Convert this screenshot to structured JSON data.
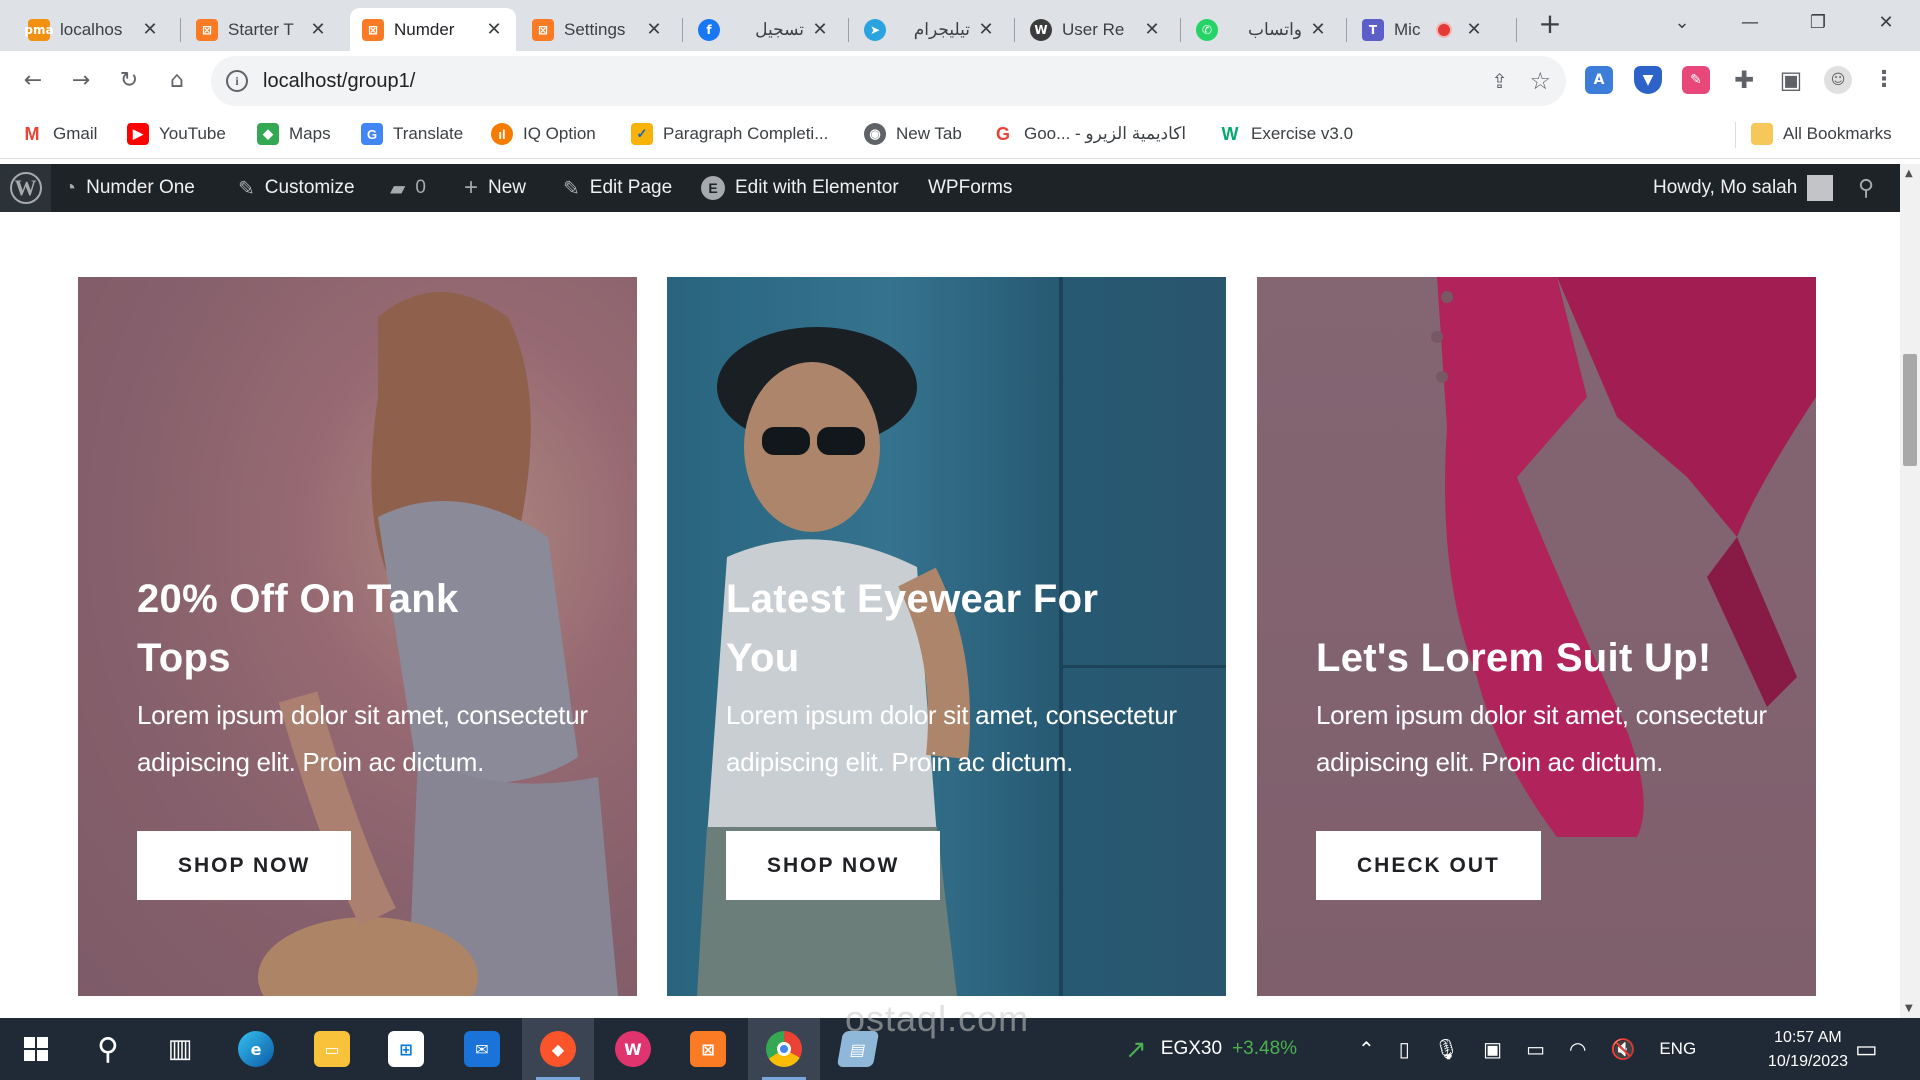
{
  "browser": {
    "tabs": [
      {
        "title": "localhos",
        "favicon": "phpmyadmin-icon",
        "color": "#f29111"
      },
      {
        "title": "Starter T",
        "favicon": "xampp-icon",
        "color": "#fb7a24"
      },
      {
        "title": "Numder",
        "favicon": "xampp-icon",
        "color": "#fb7a24"
      },
      {
        "title": "Settings",
        "favicon": "xampp-icon",
        "color": "#fb7a24"
      },
      {
        "title": "تسجيل",
        "favicon": "facebook-icon",
        "color": "#1877f2"
      },
      {
        "title": "تيليجرام",
        "favicon": "telegram-icon",
        "color": "#2aa3df"
      },
      {
        "title": "User Re",
        "favicon": "wordpress-icon",
        "color": "#3c3c3c"
      },
      {
        "title": "واتساب",
        "favicon": "whatsapp-icon",
        "color": "#25d366"
      },
      {
        "title": "Mic",
        "favicon": "teams-icon",
        "color": "#5b5fc7"
      }
    ],
    "url": "localhost/group1/",
    "bookmarks": [
      {
        "label": "Gmail",
        "icon": "gmail-icon"
      },
      {
        "label": "YouTube",
        "icon": "youtube-icon"
      },
      {
        "label": "Maps",
        "icon": "maps-icon"
      },
      {
        "label": "Translate",
        "icon": "translate-icon"
      },
      {
        "label": "IQ Option",
        "icon": "iqoption-icon"
      },
      {
        "label": "Paragraph Completi...",
        "icon": "checkbox-icon"
      },
      {
        "label": "New Tab",
        "icon": "globe-icon"
      },
      {
        "label": "Goo... - اكاديمية الزيرو",
        "icon": "google-icon"
      },
      {
        "label": "Exercise v3.0",
        "icon": "w3schools-icon"
      }
    ],
    "all_bookmarks": "All Bookmarks"
  },
  "adminbar": {
    "site": "Numder One",
    "customize": "Customize",
    "comments_count": "0",
    "new": "New",
    "edit_page": "Edit Page",
    "elementor": "Edit with Elementor",
    "wpforms": "WPForms",
    "howdy": "Howdy, Mo salah"
  },
  "cards": [
    {
      "title_line1": "20% Off On Tank",
      "title_line2": "Tops",
      "text": "Lorem ipsum dolor sit amet, consectetur adipiscing elit. Proin ac dictum.",
      "button": "SHOP NOW"
    },
    {
      "title_line1": "Latest Eyewear For",
      "title_line2": "You",
      "text": "Lorem ipsum dolor sit amet, consectetur adipiscing elit. Proin ac dictum.",
      "button": "SHOP NOW"
    },
    {
      "title_line1": "Let's Lorem Suit Up!",
      "title_line2": "",
      "text": "Lorem ipsum dolor sit amet, consectetur adipiscing elit. Proin ac dictum.",
      "button": "CHECK OUT"
    }
  ],
  "watermark": "ostaql.com",
  "taskbar": {
    "stock_name": "EGX30",
    "stock_change": "+3.48%",
    "language": "ENG",
    "time": "10:57 AM",
    "date": "10/19/2023"
  }
}
